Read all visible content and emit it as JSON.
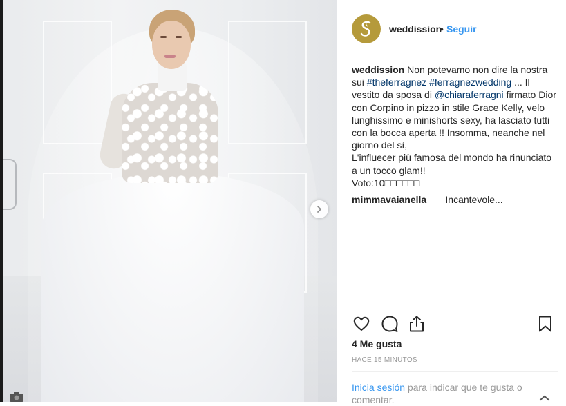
{
  "post": {
    "username": "weddission",
    "separator": "•",
    "follow_label": "Seguir",
    "caption": {
      "user": "weddission",
      "text_1": " Non potevamo non dire la nostra sui ",
      "hashtag_1": "#theferragnez",
      "space": " ",
      "hashtag_2": "#ferragnezwedding",
      "text_2": " ... Il vestito da sposa di ",
      "mention": "@chiaraferragni",
      "text_3": " firmato Dior con Corpino in pizzo in stile Grace Kelly, velo lunghissimo e minishorts sexy, ha lasciato tutti con la bocca aperta !! Insomma, neanche nel giorno del sì,",
      "text_4": "L'influecer più famosa del mondo ha rinunciato a un tocco glam!!",
      "text_5": "Voto:10□□□□□□"
    },
    "comment": {
      "user": "mimmavaianella___",
      "text": " Incantevole..."
    },
    "likes": "4 Me gusta",
    "timestamp": "HACE 15 MINUTOS",
    "login_prompt": {
      "link": "Inicia sesión",
      "text": " para indicar que te gusta o comentar."
    },
    "icons": {
      "avatar": "weddission-logo",
      "like": "heart-icon",
      "comment": "comment-bubble-icon",
      "share": "share-icon",
      "save": "bookmark-icon",
      "next": "chevron-right-icon"
    },
    "colors": {
      "link_blue": "#3897f0",
      "hashtag_blue": "#003569",
      "text": "#262626",
      "muted": "#999999",
      "avatar_gold": "#b59a3b"
    }
  }
}
